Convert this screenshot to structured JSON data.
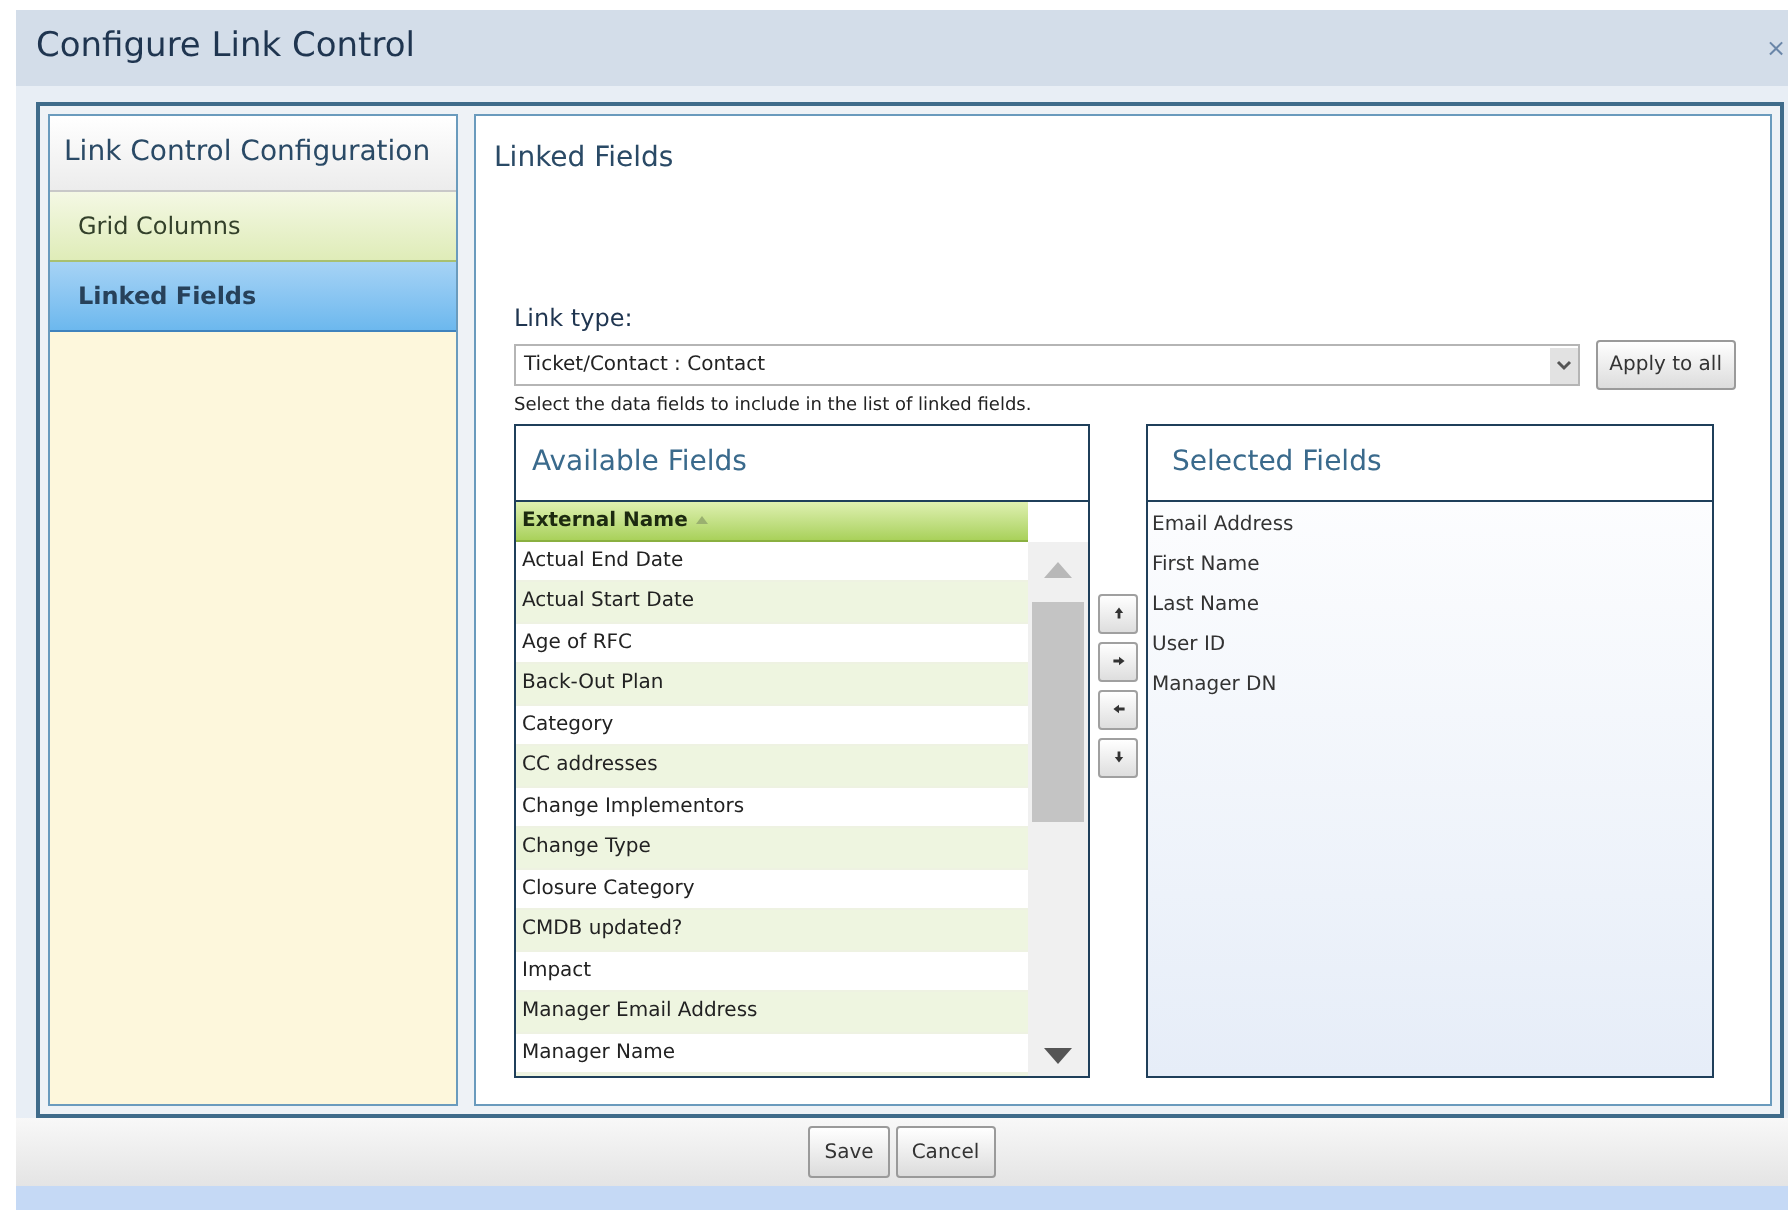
{
  "window": {
    "title": "Configure Link Control",
    "close": "×"
  },
  "sidebar": {
    "title": "Link Control Configuration",
    "items": [
      {
        "label": "Grid Columns",
        "selected": false
      },
      {
        "label": "Linked Fields",
        "selected": true
      }
    ]
  },
  "panel": {
    "title": "Linked Fields",
    "link_type_label": "Link type:",
    "link_type_value": "Ticket/Contact : Contact",
    "apply_button": "Apply to all",
    "instruction": "Select the data fields to include in the list of linked fields."
  },
  "available": {
    "title": "Available Fields",
    "column": "External Name",
    "rows": [
      "Actual End Date",
      "Actual Start Date",
      "Age of RFC",
      "Back-Out Plan",
      "Category",
      "CC addresses",
      "Change Implementors",
      "Change Type",
      "Closure Category",
      "CMDB updated?",
      "Impact",
      "Manager Email Address",
      "Manager Name"
    ]
  },
  "move_buttons": [
    {
      "kind": "up"
    },
    {
      "kind": "right"
    },
    {
      "kind": "left"
    },
    {
      "kind": "down"
    }
  ],
  "selected": {
    "title": "Selected Fields",
    "rows": [
      "Email Address",
      "First Name",
      "Last Name",
      "User ID",
      "Manager DN"
    ]
  },
  "footer": {
    "buttons": [
      "Save",
      "Cancel"
    ]
  }
}
